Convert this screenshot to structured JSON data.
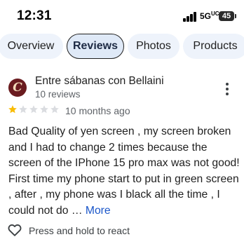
{
  "status_bar": {
    "time": "12:31",
    "network": "5G",
    "network_suffix": "UC",
    "battery": "45",
    "signal_icon": "cellular-signal-icon",
    "battery_icon": "battery-icon"
  },
  "tabs": [
    {
      "label": "Overview",
      "active": false
    },
    {
      "label": "Reviews",
      "active": true
    },
    {
      "label": "Photos",
      "active": false
    },
    {
      "label": "Products",
      "active": false
    }
  ],
  "review": {
    "reviewer_name": "Entre sábanas con Bellaini",
    "reviewer_reviews": "10 reviews",
    "avatar_letter": "C",
    "rating": 1,
    "rating_max": 5,
    "date": "10 months ago",
    "text": "Bad Quality of yen screen , my screen broken and I had to change 2 times because the screen of the IPhone 15 pro max was not good! First time my phone start to put in green screen , after , my phone was I black all the time , I could not do … ",
    "more_label": "More",
    "react_label": "Press and hold to react",
    "icons": {
      "more": "more-vert-icon",
      "star": "star-icon",
      "react": "heart-outline-icon"
    }
  },
  "colors": {
    "star_filled": "#f9bc05",
    "star_empty": "#dadce0",
    "link": "#1a56c9",
    "tab_bg": "#eef3fb",
    "tab_active_bg": "#dfe9f7",
    "avatar_bg": "#6a1b1f"
  }
}
